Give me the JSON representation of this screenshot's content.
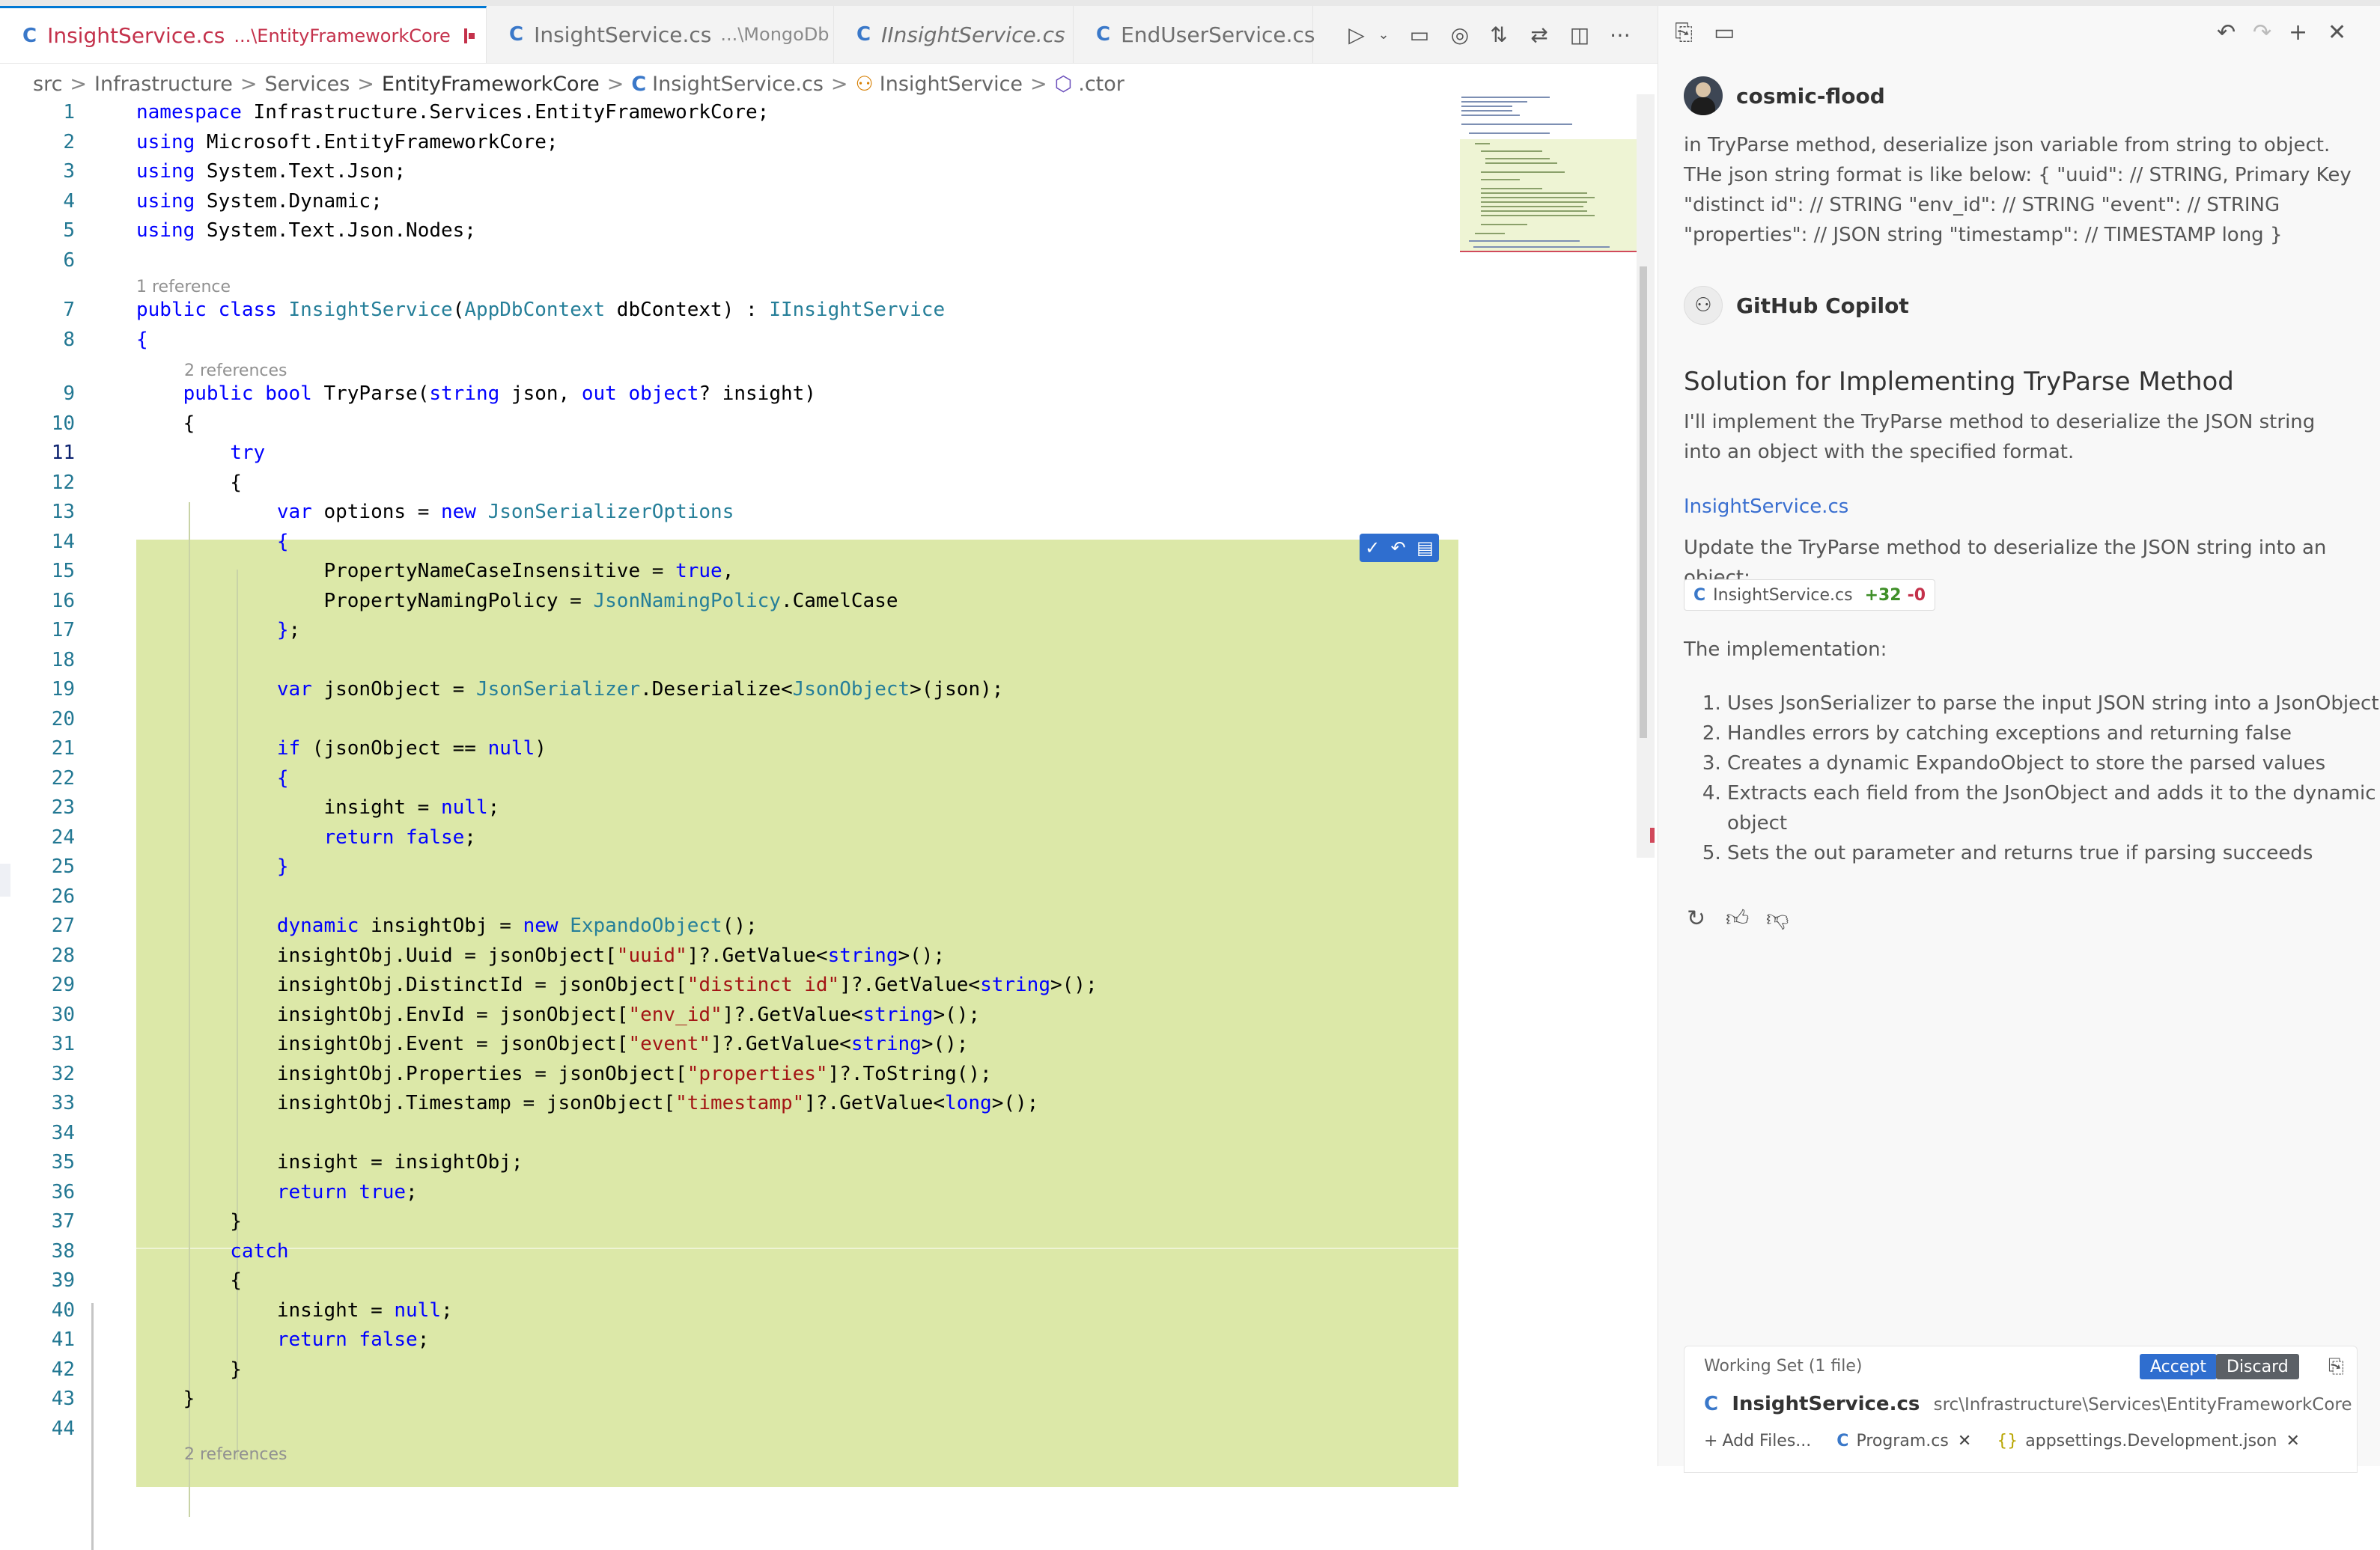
{
  "tabs": [
    {
      "label": "InsightService.cs",
      "desc": "...\\EntityFrameworkCore",
      "active": true
    },
    {
      "label": "InsightService.cs",
      "desc": "...\\MongoDb"
    },
    {
      "label": "IInsightService.cs",
      "desc": ""
    },
    {
      "label": "EndUserService.cs",
      "desc": ""
    }
  ],
  "breadcrumb": [
    "src",
    "Infrastructure",
    "Services",
    "EntityFrameworkCore",
    "InsightService.cs",
    "InsightService",
    ".ctor"
  ],
  "code": {
    "lens1": "1 reference",
    "lens2": "2 references",
    "lens3": "2 references",
    "line_numbers": [
      "1",
      "2",
      "3",
      "4",
      "5",
      "6",
      "7",
      "8",
      "9",
      "10",
      "11",
      "12",
      "13",
      "14",
      "15",
      "16",
      "17",
      "18",
      "19",
      "20",
      "21",
      "22",
      "23",
      "24",
      "25",
      "26",
      "27",
      "28",
      "29",
      "30",
      "31",
      "32",
      "33",
      "34",
      "35",
      "36",
      "37",
      "38",
      "39",
      "40",
      "41",
      "42",
      "43",
      "44"
    ]
  },
  "chat": {
    "user": "cosmic-flood",
    "prompt": "in TryParse method, deserialize json variable from string to object. THe json string format is like below: { \"uuid\": // STRING, Primary Key \"distinct id\": // STRING \"env_id\": // STRING \"event\": // STRING \"properties\": // JSON string \"timestamp\": // TIMESTAMP long }",
    "assistant": "GitHub Copilot",
    "heading": "Solution for Implementing TryParse Method",
    "intro": "I'll implement the TryParse method to deserialize the JSON string into an object with the specified format.",
    "file_link": "InsightService.cs",
    "update_text": "Update the TryParse method to deserialize the JSON string into an object:",
    "chip": {
      "name": "InsightService.cs",
      "added": "+32",
      "removed": "-0"
    },
    "impl_title": "The implementation:",
    "impl_items": [
      "Uses JsonSerializer to parse the input JSON string into a JsonObject",
      "Handles errors by catching exceptions and returning false",
      "Creates a dynamic ExpandoObject to store the parsed values",
      "Extracts each field from the JsonObject and adds it to the dynamic object",
      "Sets the out parameter and returns true if parsing succeeds"
    ],
    "working_set": {
      "title": "Working Set (1 file)",
      "accept": "Accept",
      "discard": "Discard",
      "file": "InsightService.cs",
      "path": "src\\Infrastructure\\Services\\EntityFrameworkCore",
      "add_files": "Add Files...",
      "others": [
        "Program.cs",
        "appsettings.Development.json"
      ]
    }
  },
  "colors": {
    "accent": "#2f6ecf",
    "diff_added_bg": "#dce8a8",
    "tab_modified": "#c4314b"
  }
}
